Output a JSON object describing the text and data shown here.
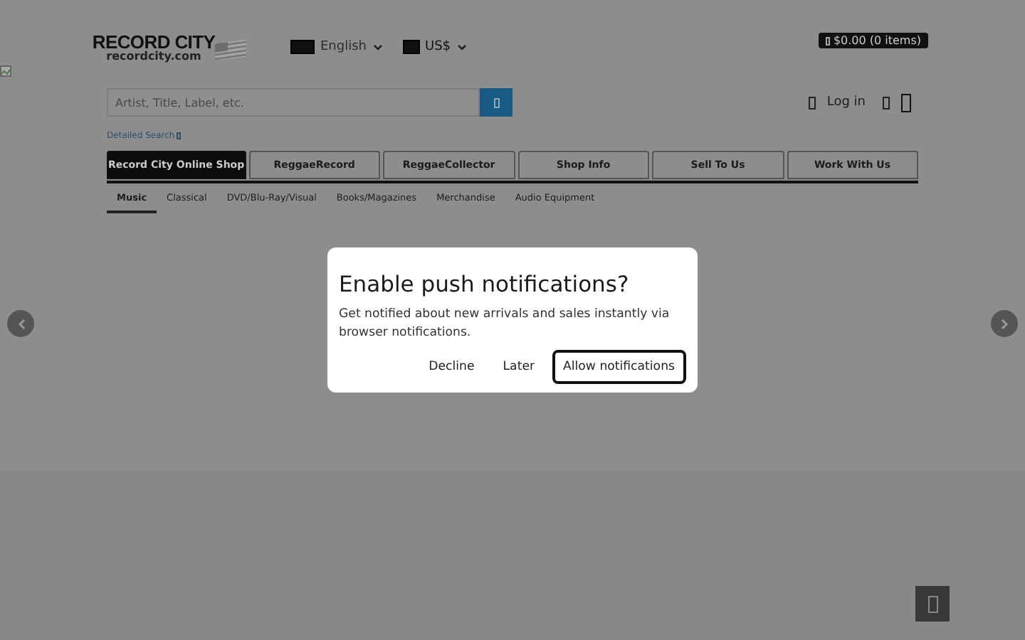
{
  "header": {
    "logo": {
      "title": "RECORD CITY",
      "subtitle": "recordcity.com"
    },
    "language": {
      "value": "English"
    },
    "currency": {
      "value": "US$"
    },
    "cart": {
      "label": "$0.00 (0 items)"
    },
    "search": {
      "placeholder": "Artist, Title, Label, etc."
    },
    "detailed_search": "Detailed Search",
    "login": "Log in"
  },
  "nav_tabs": [
    {
      "label": "Record City Online Shop",
      "selected": true
    },
    {
      "label": "ReggaeRecord",
      "selected": false
    },
    {
      "label": "ReggaeCollector",
      "selected": false
    },
    {
      "label": "Shop Info",
      "selected": false
    },
    {
      "label": "Sell To Us",
      "selected": false
    },
    {
      "label": "Work With Us",
      "selected": false
    }
  ],
  "sub_tabs": [
    {
      "label": "Music",
      "selected": true
    },
    {
      "label": "Classical",
      "selected": false
    },
    {
      "label": "DVD/Blu-Ray/Visual",
      "selected": false
    },
    {
      "label": "Books/Magazines",
      "selected": false
    },
    {
      "label": "Merchandise",
      "selected": false
    },
    {
      "label": "Audio Equipment",
      "selected": false
    }
  ],
  "dialog": {
    "title": "Enable push notifications?",
    "message": "Get notified about new arrivals and sales instantly via browser notifications.",
    "buttons": [
      {
        "label": "Decline",
        "kind": "text"
      },
      {
        "label": "Later",
        "kind": "text"
      },
      {
        "label": "Allow notifications",
        "kind": "outlined"
      }
    ]
  }
}
